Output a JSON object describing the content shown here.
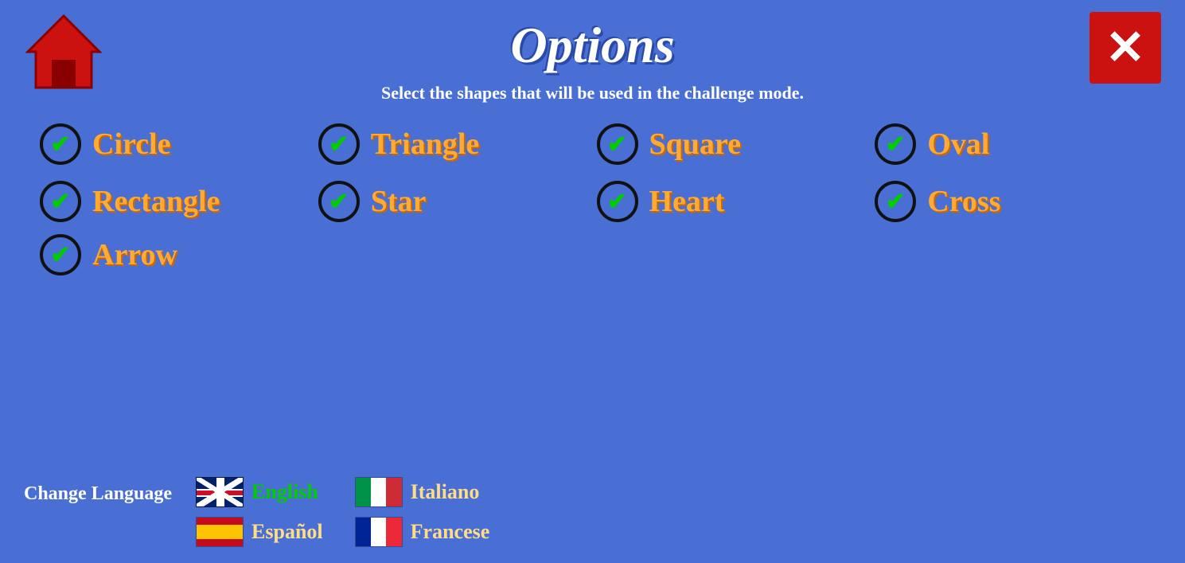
{
  "title": "Options",
  "subtitle": "Select the shapes that will be used in the challenge mode.",
  "home_button": "home",
  "close_button": "×",
  "shapes": [
    {
      "id": "circle",
      "label": "Circle",
      "checked": true
    },
    {
      "id": "triangle",
      "label": "Triangle",
      "checked": true
    },
    {
      "id": "square",
      "label": "Square",
      "checked": true
    },
    {
      "id": "oval",
      "label": "Oval",
      "checked": true
    },
    {
      "id": "rectangle",
      "label": "Rectangle",
      "checked": true
    },
    {
      "id": "star",
      "label": "Star",
      "checked": true
    },
    {
      "id": "heart",
      "label": "Heart",
      "checked": true
    },
    {
      "id": "cross",
      "label": "Cross",
      "checked": true
    },
    {
      "id": "arrow",
      "label": "Arrow",
      "checked": true
    }
  ],
  "language_section": {
    "label": "Change Language",
    "languages": [
      {
        "id": "english",
        "label": "English",
        "active": true,
        "flag": "uk",
        "row": 1,
        "col": 1
      },
      {
        "id": "italiano",
        "label": "Italiano",
        "active": false,
        "flag": "italy",
        "row": 1,
        "col": 2
      },
      {
        "id": "espanol",
        "label": "Español",
        "active": false,
        "flag": "spain",
        "row": 2,
        "col": 1
      },
      {
        "id": "francese",
        "label": "Francese",
        "active": false,
        "flag": "france",
        "row": 2,
        "col": 2
      }
    ]
  }
}
